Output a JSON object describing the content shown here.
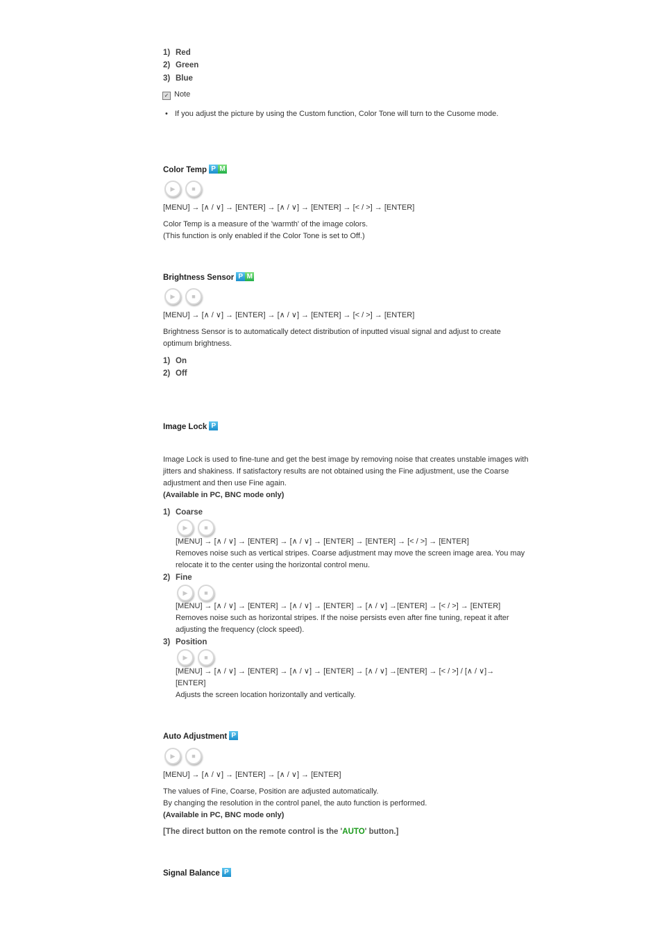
{
  "top_list": [
    {
      "num": "1)",
      "label": "Red"
    },
    {
      "num": "2)",
      "label": "Green"
    },
    {
      "num": "3)",
      "label": "Blue"
    }
  ],
  "note": {
    "icon": "checkbox-note-icon",
    "label": "Note",
    "bullet": "•",
    "text": "If you adjust the picture by using the Custom function, Color Tone will turn to the Cusome mode."
  },
  "badges": {
    "p": "P",
    "m": "M"
  },
  "buttons": {
    "play_glyph": "▶",
    "stop_glyph": "■"
  },
  "color_temp": {
    "title": "Color Temp",
    "path": "[MENU] → [∧ / ∨] → [ENTER] → [∧ / ∨] → [ENTER] → [< / >] → [ENTER]",
    "desc1": "Color Temp is a measure of the 'warmth' of the image colors.",
    "desc2": "(This function is only enabled if the Color Tone is set to Off.)"
  },
  "brightness_sensor": {
    "title": "Brightness Sensor",
    "path": "[MENU] → [∧ / ∨] → [ENTER] → [∧ / ∨] → [ENTER] → [< / >] → [ENTER]",
    "desc": "Brightness Sensor is to automatically detect distribution of inputted visual signal and adjust to create optimum brightness.",
    "options": [
      {
        "num": "1)",
        "label": "On"
      },
      {
        "num": "2)",
        "label": "Off"
      }
    ]
  },
  "image_lock": {
    "title": "Image Lock",
    "desc": "Image Lock is used to fine-tune and get the best image by removing noise that creates unstable images with jitters and shakiness. If satisfactory results are not obtained using the Fine adjustment, use the Coarse adjustment and then use Fine again.",
    "availability": "(Available in PC, BNC mode only)",
    "items": [
      {
        "num": "1)",
        "label": "Coarse",
        "path": "[MENU] → [∧ / ∨] → [ENTER] → [∧ / ∨] → [ENTER] → [ENTER] → [< / >] → [ENTER]",
        "desc": "Removes noise such as vertical stripes. Coarse adjustment may move the screen image area. You may relocate it to the center using the horizontal control menu."
      },
      {
        "num": "2)",
        "label": "Fine",
        "path": "[MENU] → [∧ / ∨] → [ENTER] → [∧ / ∨] → [ENTER] → [∧ / ∨] →[ENTER] → [< / >] → [ENTER]",
        "desc": "Removes noise such as horizontal stripes. If the noise persists even after fine tuning, repeat it after adjusting the frequency (clock speed)."
      },
      {
        "num": "3)",
        "label": "Position",
        "path": "[MENU] → [∧ / ∨] → [ENTER] → [∧ / ∨] → [ENTER] → [∧ / ∨] →[ENTER] → [< / >] / [∧ / ∨]→ [ENTER]",
        "desc": "Adjusts the screen location horizontally and vertically."
      }
    ]
  },
  "auto_adjustment": {
    "title": "Auto Adjustment",
    "path": "[MENU] → [∧ / ∨] → [ENTER] → [∧ / ∨] → [ENTER]",
    "desc1": "The values of Fine, Coarse, Position are adjusted automatically.",
    "desc2": "By changing the resolution in the control panel, the auto function is performed.",
    "availability": "(Available in PC, BNC mode only)",
    "direct_pre": "[The direct button on the remote control is the '",
    "direct_key": "AUTO",
    "direct_post": "' button.]"
  },
  "signal_balance": {
    "title": "Signal Balance"
  }
}
